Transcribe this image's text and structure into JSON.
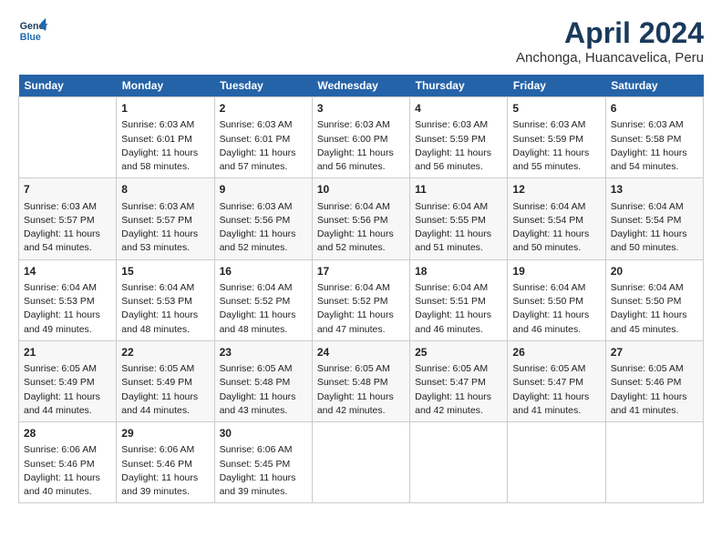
{
  "logo": {
    "line1": "General",
    "line2": "Blue"
  },
  "title": "April 2024",
  "subtitle": "Anchonga, Huancavelica, Peru",
  "days_header": [
    "Sunday",
    "Monday",
    "Tuesday",
    "Wednesday",
    "Thursday",
    "Friday",
    "Saturday"
  ],
  "weeks": [
    [
      {
        "day": "",
        "info": ""
      },
      {
        "day": "1",
        "info": "Sunrise: 6:03 AM\nSunset: 6:01 PM\nDaylight: 11 hours\nand 58 minutes."
      },
      {
        "day": "2",
        "info": "Sunrise: 6:03 AM\nSunset: 6:01 PM\nDaylight: 11 hours\nand 57 minutes."
      },
      {
        "day": "3",
        "info": "Sunrise: 6:03 AM\nSunset: 6:00 PM\nDaylight: 11 hours\nand 56 minutes."
      },
      {
        "day": "4",
        "info": "Sunrise: 6:03 AM\nSunset: 5:59 PM\nDaylight: 11 hours\nand 56 minutes."
      },
      {
        "day": "5",
        "info": "Sunrise: 6:03 AM\nSunset: 5:59 PM\nDaylight: 11 hours\nand 55 minutes."
      },
      {
        "day": "6",
        "info": "Sunrise: 6:03 AM\nSunset: 5:58 PM\nDaylight: 11 hours\nand 54 minutes."
      }
    ],
    [
      {
        "day": "7",
        "info": "Sunrise: 6:03 AM\nSunset: 5:57 PM\nDaylight: 11 hours\nand 54 minutes."
      },
      {
        "day": "8",
        "info": "Sunrise: 6:03 AM\nSunset: 5:57 PM\nDaylight: 11 hours\nand 53 minutes."
      },
      {
        "day": "9",
        "info": "Sunrise: 6:03 AM\nSunset: 5:56 PM\nDaylight: 11 hours\nand 52 minutes."
      },
      {
        "day": "10",
        "info": "Sunrise: 6:04 AM\nSunset: 5:56 PM\nDaylight: 11 hours\nand 52 minutes."
      },
      {
        "day": "11",
        "info": "Sunrise: 6:04 AM\nSunset: 5:55 PM\nDaylight: 11 hours\nand 51 minutes."
      },
      {
        "day": "12",
        "info": "Sunrise: 6:04 AM\nSunset: 5:54 PM\nDaylight: 11 hours\nand 50 minutes."
      },
      {
        "day": "13",
        "info": "Sunrise: 6:04 AM\nSunset: 5:54 PM\nDaylight: 11 hours\nand 50 minutes."
      }
    ],
    [
      {
        "day": "14",
        "info": "Sunrise: 6:04 AM\nSunset: 5:53 PM\nDaylight: 11 hours\nand 49 minutes."
      },
      {
        "day": "15",
        "info": "Sunrise: 6:04 AM\nSunset: 5:53 PM\nDaylight: 11 hours\nand 48 minutes."
      },
      {
        "day": "16",
        "info": "Sunrise: 6:04 AM\nSunset: 5:52 PM\nDaylight: 11 hours\nand 48 minutes."
      },
      {
        "day": "17",
        "info": "Sunrise: 6:04 AM\nSunset: 5:52 PM\nDaylight: 11 hours\nand 47 minutes."
      },
      {
        "day": "18",
        "info": "Sunrise: 6:04 AM\nSunset: 5:51 PM\nDaylight: 11 hours\nand 46 minutes."
      },
      {
        "day": "19",
        "info": "Sunrise: 6:04 AM\nSunset: 5:50 PM\nDaylight: 11 hours\nand 46 minutes."
      },
      {
        "day": "20",
        "info": "Sunrise: 6:04 AM\nSunset: 5:50 PM\nDaylight: 11 hours\nand 45 minutes."
      }
    ],
    [
      {
        "day": "21",
        "info": "Sunrise: 6:05 AM\nSunset: 5:49 PM\nDaylight: 11 hours\nand 44 minutes."
      },
      {
        "day": "22",
        "info": "Sunrise: 6:05 AM\nSunset: 5:49 PM\nDaylight: 11 hours\nand 44 minutes."
      },
      {
        "day": "23",
        "info": "Sunrise: 6:05 AM\nSunset: 5:48 PM\nDaylight: 11 hours\nand 43 minutes."
      },
      {
        "day": "24",
        "info": "Sunrise: 6:05 AM\nSunset: 5:48 PM\nDaylight: 11 hours\nand 42 minutes."
      },
      {
        "day": "25",
        "info": "Sunrise: 6:05 AM\nSunset: 5:47 PM\nDaylight: 11 hours\nand 42 minutes."
      },
      {
        "day": "26",
        "info": "Sunrise: 6:05 AM\nSunset: 5:47 PM\nDaylight: 11 hours\nand 41 minutes."
      },
      {
        "day": "27",
        "info": "Sunrise: 6:05 AM\nSunset: 5:46 PM\nDaylight: 11 hours\nand 41 minutes."
      }
    ],
    [
      {
        "day": "28",
        "info": "Sunrise: 6:06 AM\nSunset: 5:46 PM\nDaylight: 11 hours\nand 40 minutes."
      },
      {
        "day": "29",
        "info": "Sunrise: 6:06 AM\nSunset: 5:46 PM\nDaylight: 11 hours\nand 39 minutes."
      },
      {
        "day": "30",
        "info": "Sunrise: 6:06 AM\nSunset: 5:45 PM\nDaylight: 11 hours\nand 39 minutes."
      },
      {
        "day": "",
        "info": ""
      },
      {
        "day": "",
        "info": ""
      },
      {
        "day": "",
        "info": ""
      },
      {
        "day": "",
        "info": ""
      }
    ]
  ]
}
